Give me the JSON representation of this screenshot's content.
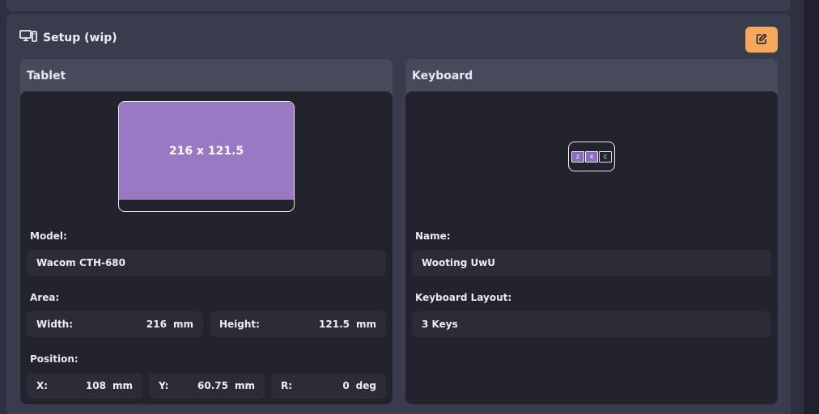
{
  "card": {
    "title": "Setup (wip)",
    "edit_icon": "edit-icon"
  },
  "tablet": {
    "panel_title": "Tablet",
    "preview_label": "216 x 121.5",
    "model_label": "Model:",
    "model_value": "Wacom CTH-680",
    "area_label": "Area:",
    "width_label": "Width:",
    "width_value": "216",
    "width_unit": "mm",
    "height_label": "Height:",
    "height_value": "121.5",
    "height_unit": "mm",
    "position_label": "Position:",
    "x_label": "X:",
    "x_value": "108",
    "x_unit": "mm",
    "y_label": "Y:",
    "y_value": "60.75",
    "y_unit": "mm",
    "r_label": "R:",
    "r_value": "0",
    "r_unit": "deg"
  },
  "keyboard": {
    "panel_title": "Keyboard",
    "keys": [
      {
        "label": "z",
        "active": true
      },
      {
        "label": "x",
        "active": true
      },
      {
        "label": "c",
        "active": false
      }
    ],
    "name_label": "Name:",
    "name_value": "Wooting UwU",
    "layout_label": "Keyboard Layout:",
    "layout_value": "3 Keys"
  },
  "colors": {
    "accent_button": "#f5a85b",
    "tablet_area": "#9979c4",
    "active_key": "#8b6cc0"
  }
}
